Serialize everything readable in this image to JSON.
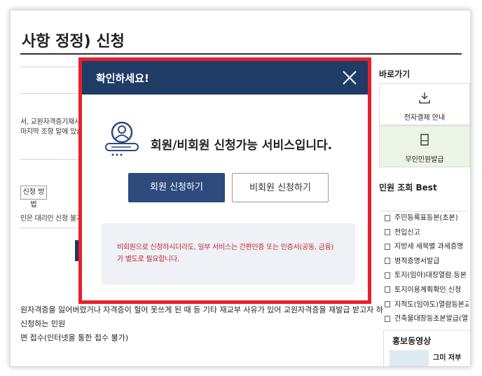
{
  "page": {
    "title": "사항 정정) 신청"
  },
  "background": {
    "text_line_1": "서, 교원자격증기재사",
    "text_line_2": "마지막 조항 밑에 있습니",
    "method_chip": "신청 방법",
    "proxy_note": "인은 대리인 신청 불가)",
    "bottom_lines": [
      "원자격증을 잃어버렸거나 자격증이 헐어 못쓰게 된 때 등 기타 재교부 사유가 있어 교원자격증을 재발급 받고자 하",
      "신청하는 민원",
      "면 접수(인터넷을 통한 접수 불가)"
    ]
  },
  "sidebar": {
    "shortcuts_title": "바로가기",
    "shortcuts": [
      {
        "label": "전자결제 안내",
        "icon": "payment-icon"
      },
      {
        "label": "무인민원발급",
        "icon": "kiosk-icon"
      }
    ],
    "best_title": "민원 조회 Best",
    "best_items": [
      "주민등록표등본(초본)",
      "전입신고",
      "지방세 세목별 과세증명",
      "병적증명서발급",
      "토지(임야)대장열람.등본",
      "토지이용계획확인 신청",
      "지적도(임야도)열람등본교",
      "건축물대장등초본발급(열"
    ],
    "promo_title": "홍보동영상",
    "promo_caption": "그미 저부"
  },
  "modal": {
    "title": "확인하세요!",
    "message": "회원/비회원 신청가능 서비스입니다.",
    "member_button": "회원 신청하기",
    "guest_button": "비회원 신청하기",
    "notice": "비회원으로 신청하시더라도, 일부 서비스는 간편인증 또는 인증서(공동, 금융) 가 별도로 필요합니다."
  },
  "colors": {
    "modal_header": "#1f3c66",
    "primary_button": "#2e4a7d",
    "highlight_border": "#e8202a",
    "notice_text": "#c2272d"
  }
}
